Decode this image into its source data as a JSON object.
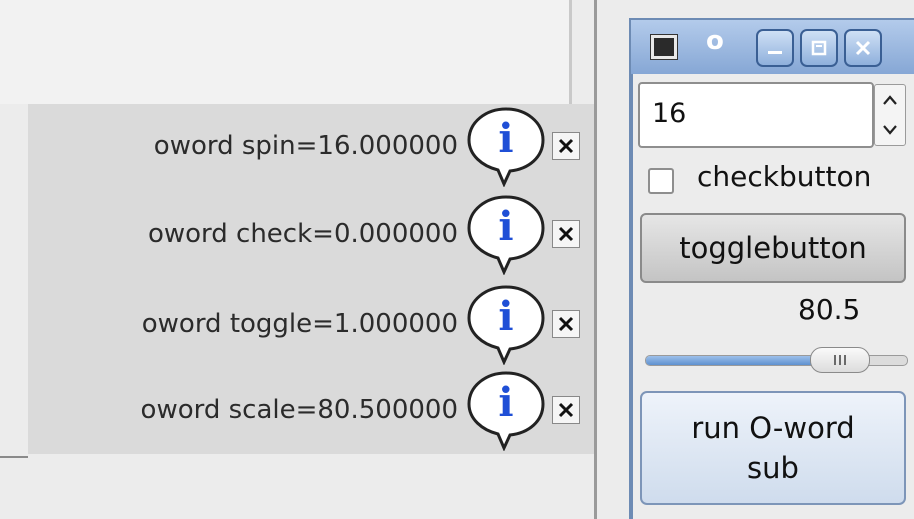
{
  "messages": [
    {
      "text": "oword spin=16.000000",
      "icon": "info-bubble-icon",
      "close_icon": "close-icon"
    },
    {
      "text": "oword check=0.000000",
      "icon": "info-bubble-icon",
      "close_icon": "close-icon"
    },
    {
      "text": "oword toggle=1.000000",
      "icon": "info-bubble-icon",
      "close_icon": "close-icon"
    },
    {
      "text": "oword scale=80.500000",
      "icon": "info-bubble-icon",
      "close_icon": "close-icon"
    }
  ],
  "window": {
    "title": "o",
    "buttons": [
      "minimize-icon",
      "maximize-icon",
      "close-icon"
    ]
  },
  "panel": {
    "spin_value": "16",
    "checkbox_label": "checkbutton",
    "checkbox_checked": false,
    "toggle_label": "togglebutton",
    "scale_value": "80.5",
    "scale_fraction": 0.7,
    "run_label": "run O-word sub"
  },
  "colors": {
    "info_blue": "#1f4fd6",
    "titlebar": "#9dbbe3",
    "scale_fill": "#6f9ed6"
  }
}
